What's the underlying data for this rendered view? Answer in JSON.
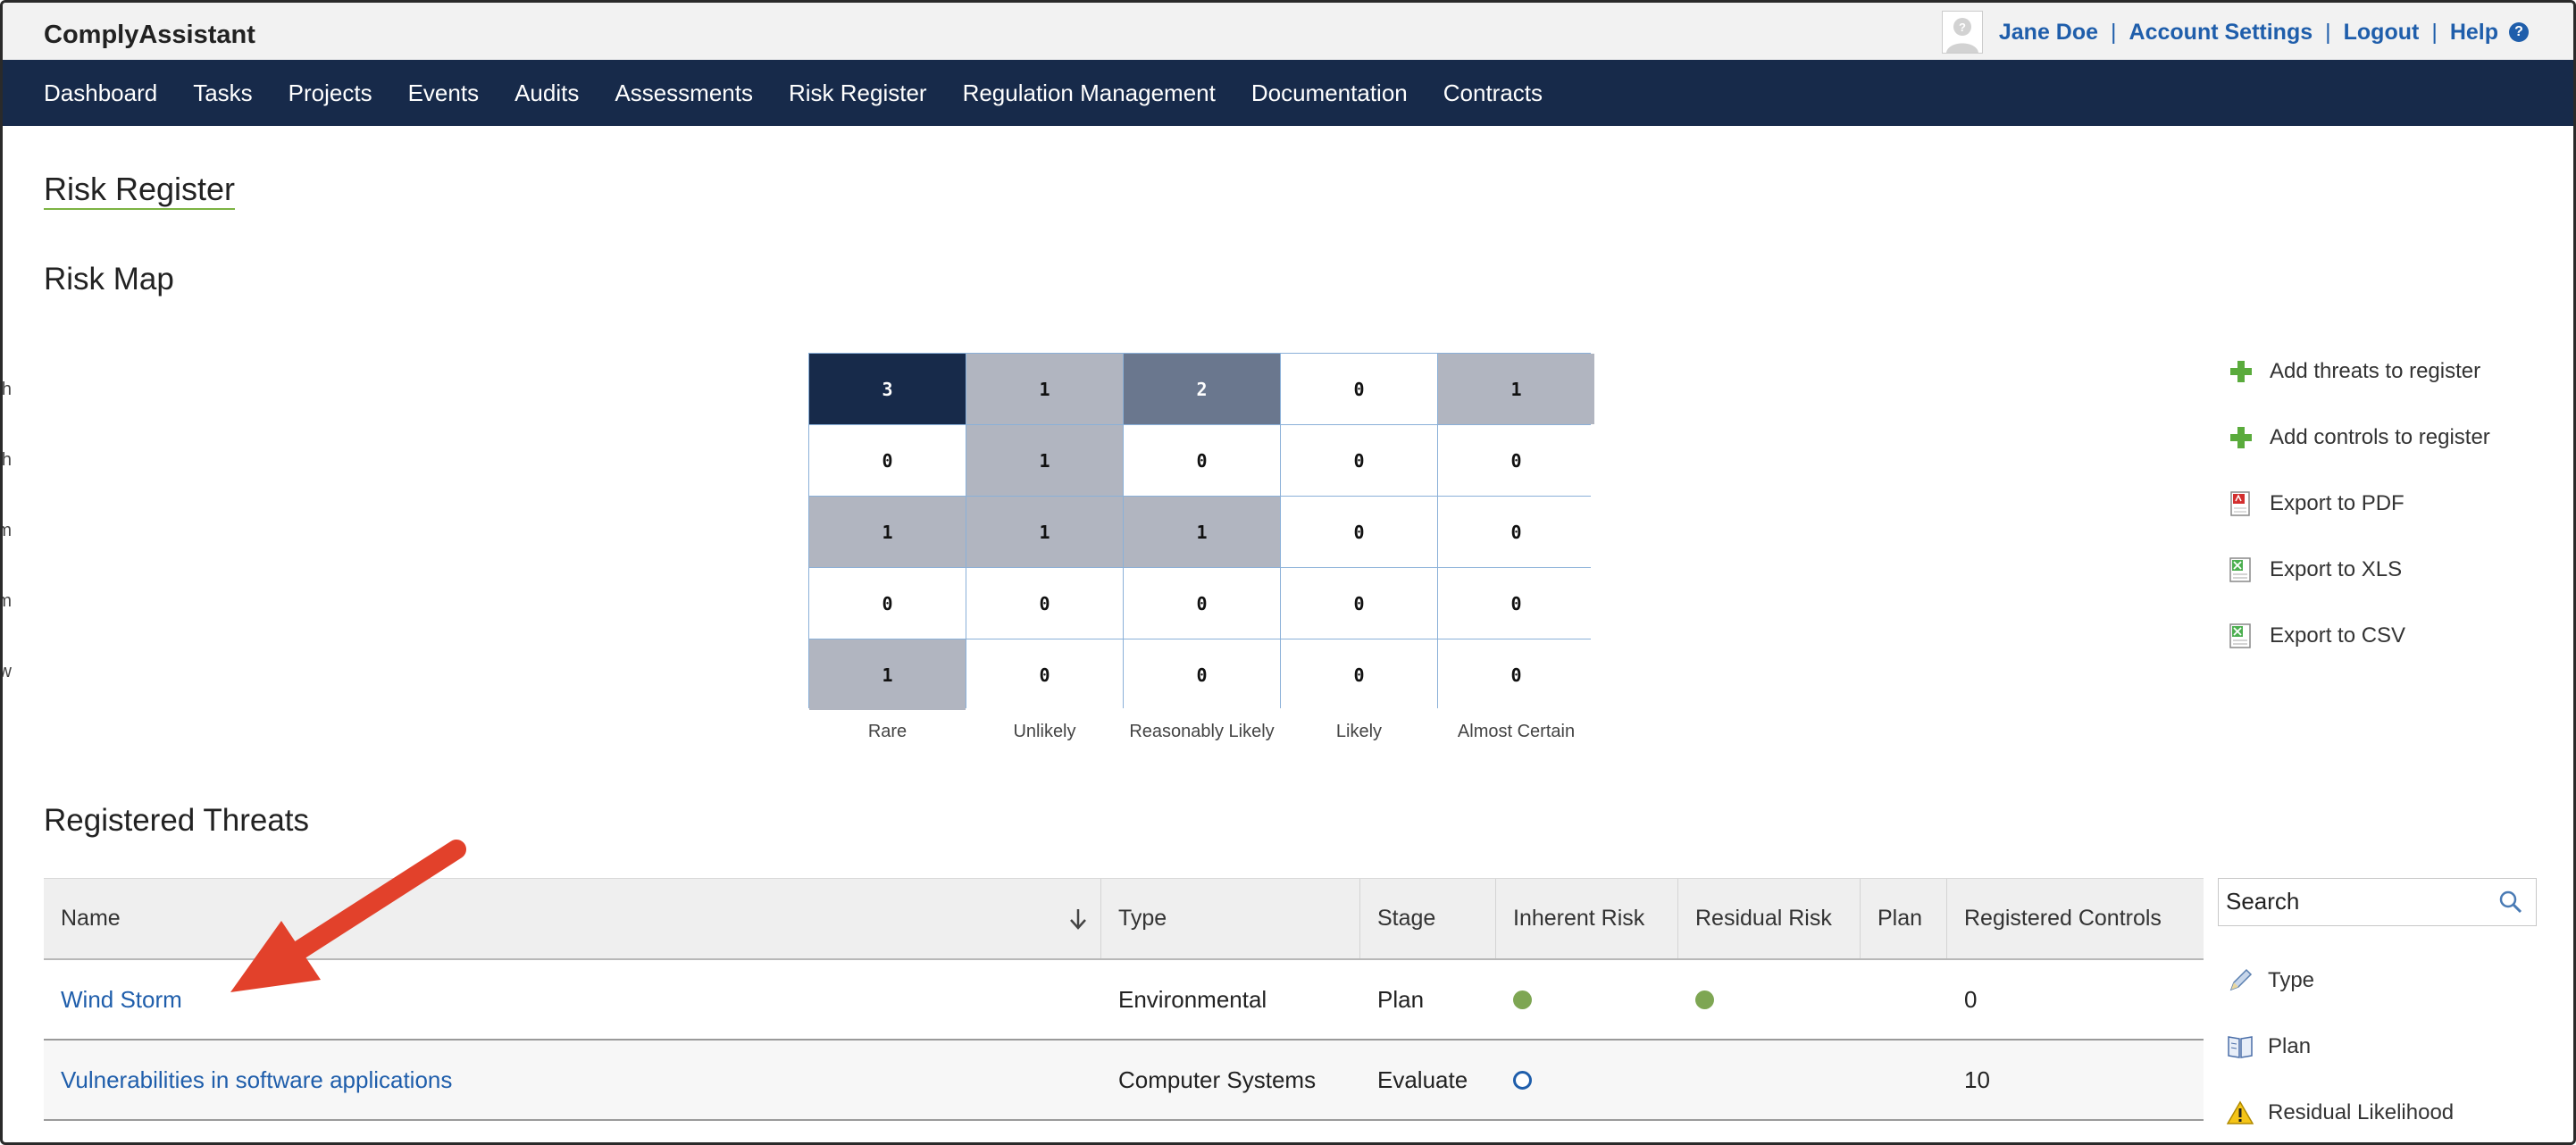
{
  "app": {
    "title": "ComplyAssistant"
  },
  "user": {
    "name": "Jane Doe",
    "account_settings": "Account Settings",
    "logout": "Logout",
    "help": "Help"
  },
  "nav": [
    "Dashboard",
    "Tasks",
    "Projects",
    "Events",
    "Audits",
    "Assessments",
    "Risk Register",
    "Regulation Management",
    "Documentation",
    "Contracts"
  ],
  "page": {
    "title": "Risk Register"
  },
  "risk_map": {
    "title": "Risk Map",
    "y_labels": [
      "High",
      "Medium / High",
      "Medium",
      "Low / Medium",
      "Low"
    ],
    "x_labels": [
      "Rare",
      "Unlikely",
      "Reasonably Likely",
      "Likely",
      "Almost Certain"
    ],
    "matrix": [
      [
        3,
        1,
        2,
        0,
        1
      ],
      [
        0,
        1,
        0,
        0,
        0
      ],
      [
        1,
        1,
        1,
        0,
        0
      ],
      [
        0,
        0,
        0,
        0,
        0
      ],
      [
        1,
        0,
        0,
        0,
        0
      ]
    ],
    "shades": {
      "0": "#ffffff",
      "1": "#b1b5c0",
      "2": "#6a778e",
      "3": "#172a4a"
    }
  },
  "actions": [
    {
      "label": "Add threats to register",
      "icon": "plus-icon"
    },
    {
      "label": "Add controls to register",
      "icon": "plus-icon"
    },
    {
      "label": "Export to PDF",
      "icon": "pdf-icon"
    },
    {
      "label": "Export to XLS",
      "icon": "spreadsheet-icon"
    },
    {
      "label": "Export to CSV",
      "icon": "spreadsheet-icon"
    }
  ],
  "threats": {
    "title": "Registered Threats",
    "columns": [
      "Name",
      "Type",
      "Stage",
      "Inherent Risk",
      "Residual Risk",
      "Plan",
      "Registered Controls"
    ],
    "rows": [
      {
        "name": "Wind Storm",
        "type": "Environmental",
        "stage": "Plan",
        "inherent": "green-dot",
        "residual": "green-dot",
        "plan": "",
        "controls": "0"
      },
      {
        "name": "Vulnerabilities in software applications",
        "type": "Computer Systems",
        "stage": "Evaluate",
        "inherent": "blue-ring",
        "residual": "",
        "plan": "",
        "controls": "10"
      }
    ]
  },
  "search": {
    "placeholder": "Search"
  },
  "filters": [
    {
      "label": "Type",
      "icon": "pencil-icon"
    },
    {
      "label": "Plan",
      "icon": "book-icon"
    },
    {
      "label": "Residual Likelihood",
      "icon": "warning-icon"
    }
  ],
  "colors": {
    "nav_bg": "#172a4a",
    "link": "#1f5eab",
    "accent_green": "#7ea653",
    "annotation_arrow": "#e2412b"
  }
}
